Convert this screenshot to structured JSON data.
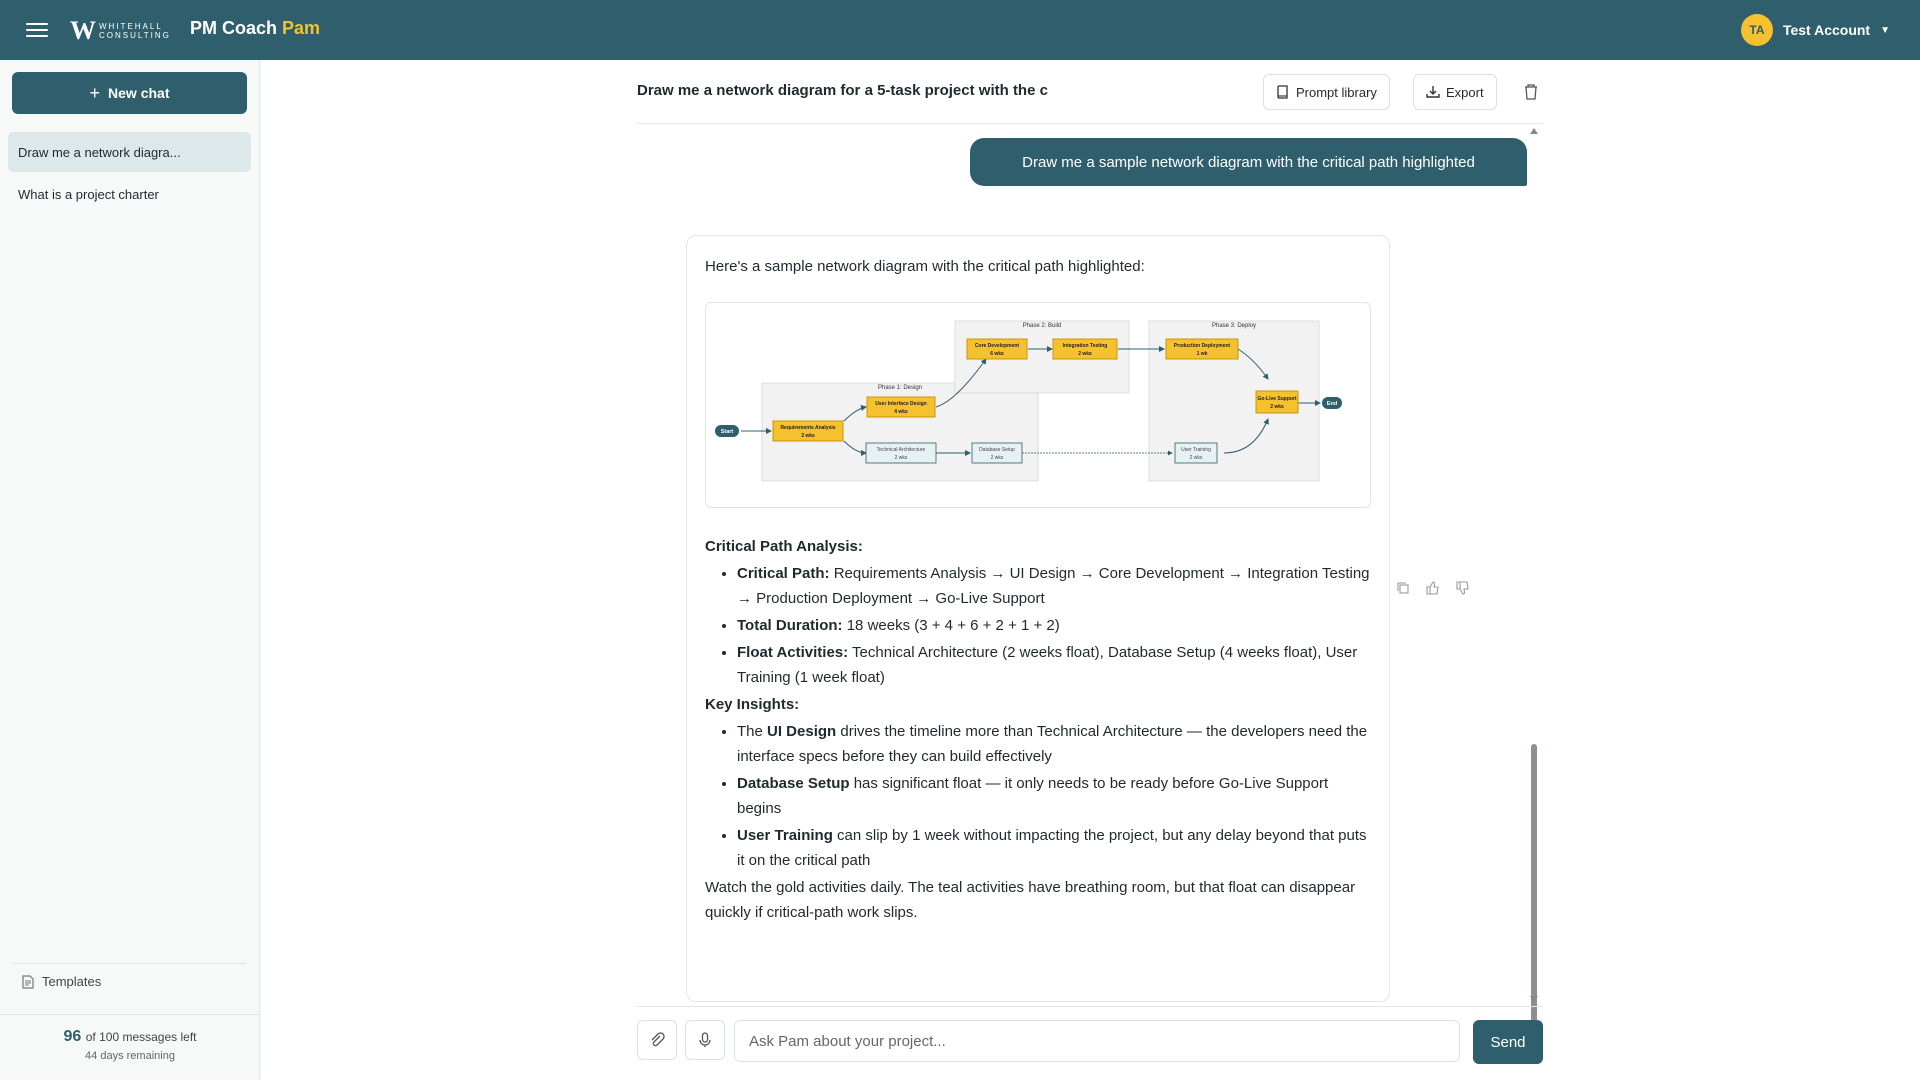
{
  "header": {
    "logo_mark": "W",
    "logo_line1": "WHITEHALL",
    "logo_line2": "CONSULTING",
    "app_title_main": "PM Coach ",
    "app_title_accent": "Pam",
    "avatar_initials": "TA",
    "account_name": "Test Account"
  },
  "sidebar": {
    "new_chat_label": "New chat",
    "chats": [
      {
        "label": "Draw me a network diagra...",
        "active": true
      },
      {
        "label": "What is a project charter",
        "active": false
      }
    ],
    "templates_label": "Templates",
    "quota_count": "96",
    "quota_text": "of 100 messages left",
    "days_remaining": "44 days remaining"
  },
  "conversation": {
    "title": "Draw me a network diagram for a 5-task project with the c",
    "prompt_library_label": "Prompt library",
    "export_label": "Export",
    "user_message": "Draw me a sample network diagram with the critical path highlighted",
    "bot_intro": "Here's a sample network diagram with the critical path highlighted:",
    "diagram": {
      "phases": [
        "Phase 1: Design",
        "Phase 2: Build",
        "Phase 3: Deploy"
      ],
      "start": "Start",
      "end": "End",
      "nodes": [
        {
          "name": "Requirements Analysis",
          "duration": "3 wks",
          "critical": true
        },
        {
          "name": "User Interface Design",
          "duration": "4 wks",
          "critical": true
        },
        {
          "name": "Technical Architecture",
          "duration": "2 wks",
          "critical": false
        },
        {
          "name": "Core Development",
          "duration": "6 wks",
          "critical": true
        },
        {
          "name": "Integration Testing",
          "duration": "2 wks",
          "critical": true
        },
        {
          "name": "Database Setup",
          "duration": "2 wks",
          "critical": false
        },
        {
          "name": "Production Deployment",
          "duration": "1 wk",
          "critical": true
        },
        {
          "name": "User Training",
          "duration": "2 wks",
          "critical": false
        },
        {
          "name": "Go-Live Support",
          "duration": "2 wks",
          "critical": true
        }
      ]
    },
    "analysis_heading": "Critical Path Analysis:",
    "analysis": [
      {
        "bold": "Critical Path:",
        "text": " Requirements Analysis → UI Design → Core Development → Integration Testing → Production Deployment → Go-Live Support"
      },
      {
        "bold": "Total Duration:",
        "text": " 18 weeks (3 + 4 + 6 + 2 + 1 + 2)"
      },
      {
        "bold": "Float Activities:",
        "text": " Technical Architecture (2 weeks float), Database Setup (4 weeks float), User Training (1 week float)"
      }
    ],
    "insights_heading": "Key Insights:",
    "insights": [
      {
        "pre": "The ",
        "bold": "UI Design",
        "text": " drives the timeline more than Technical Architecture — the developers need the interface specs before they can build effectively"
      },
      {
        "pre": "",
        "bold": "Database Setup",
        "text": " has significant float — it only needs to be ready before Go-Live Support begins"
      },
      {
        "pre": "",
        "bold": "User Training",
        "text": " can slip by 1 week without impacting the project, but any delay beyond that puts it on the critical path"
      }
    ],
    "closing": "Watch the gold activities daily. The teal activities have breathing room, but that float can disappear quickly if critical-path work slips."
  },
  "composer": {
    "placeholder": "Ask Pam about your project...",
    "send_label": "Send"
  },
  "colors": {
    "brand": "#2f5f6c",
    "accent": "#f5c12e",
    "critical": "#f5c12e",
    "noncritical": "#e6f1f1"
  }
}
